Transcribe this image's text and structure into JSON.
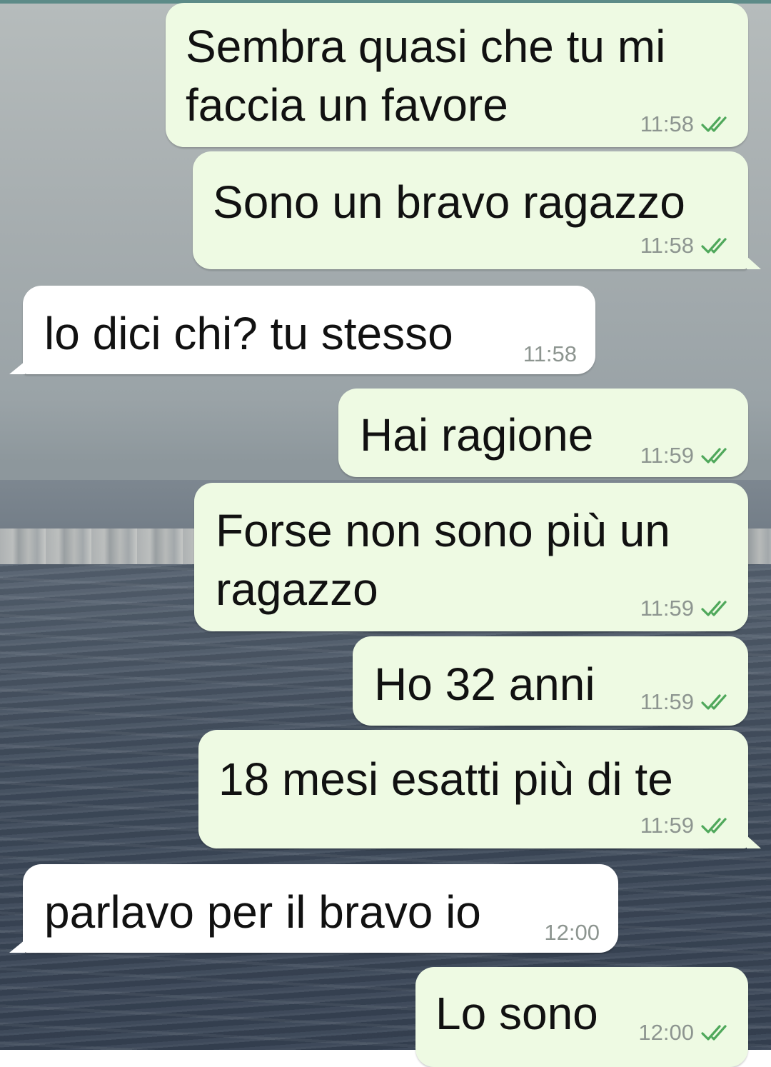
{
  "conversation": {
    "messages": [
      {
        "direction": "outgoing",
        "text": "Sembra quasi che tu mi\nfaccia un favore",
        "time": "11:58",
        "read_ticks": "double-check-icon"
      },
      {
        "direction": "outgoing",
        "text": "Sono un bravo ragazzo",
        "time": "11:58",
        "read_ticks": "double-check-icon"
      },
      {
        "direction": "incoming",
        "text": "lo dici chi? tu stesso",
        "time": "11:58"
      },
      {
        "direction": "outgoing",
        "text": "Hai ragione",
        "time": "11:59",
        "read_ticks": "double-check-icon"
      },
      {
        "direction": "outgoing",
        "text": "Forse non sono più un\nragazzo",
        "time": "11:59",
        "read_ticks": "double-check-icon"
      },
      {
        "direction": "outgoing",
        "text": "Ho 32 anni",
        "time": "11:59",
        "read_ticks": "double-check-icon"
      },
      {
        "direction": "outgoing",
        "text": "18 mesi esatti più di te",
        "time": "11:59",
        "read_ticks": "double-check-icon"
      },
      {
        "direction": "incoming",
        "text": "parlavo per il bravo io",
        "time": "12:00"
      },
      {
        "direction": "outgoing",
        "text": "Lo sono",
        "time": "12:00",
        "read_ticks": "double-check-icon"
      }
    ]
  },
  "colors": {
    "outgoing_bubble": "#eefae3",
    "incoming_bubble": "#ffffff",
    "tick_color": "#4fa85b",
    "timestamp": "#8d9590"
  }
}
